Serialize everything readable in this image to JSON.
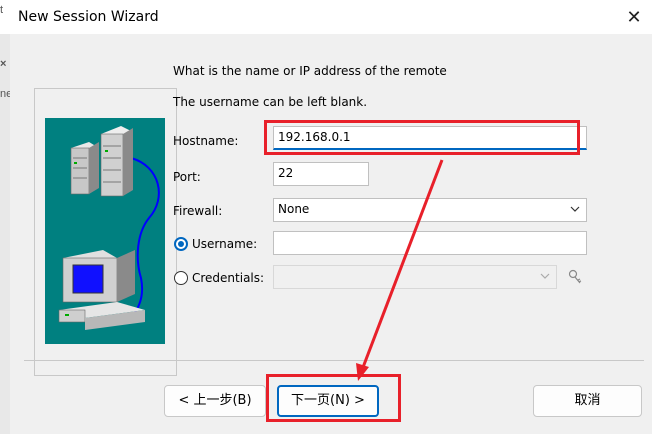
{
  "window": {
    "title": "New Session Wizard"
  },
  "left_strip": [
    "t",
    "×",
    "ne"
  ],
  "prompt": {
    "line1": "What is the name or IP address of the remote",
    "line2": "The username can be left blank."
  },
  "form": {
    "hostname_label": "Hostname:",
    "hostname_value": "192.168.0.1",
    "port_label": "Port:",
    "port_value": "22",
    "firewall_label": "Firewall:",
    "firewall_value": "None",
    "username_label": "Username:",
    "username_value": "",
    "credentials_label": "Credentials:",
    "credentials_value": ""
  },
  "buttons": {
    "back": "< 上一步(B)",
    "next": "下一页(N) >",
    "cancel": "取消"
  },
  "colors": {
    "illustration_bg": "#008080",
    "accent": "#0067c0",
    "annotation": "#e8202a"
  },
  "icons": {
    "close": "close-icon",
    "credentials_key": "key-icon",
    "dropdown": "chevron-down-icon"
  }
}
